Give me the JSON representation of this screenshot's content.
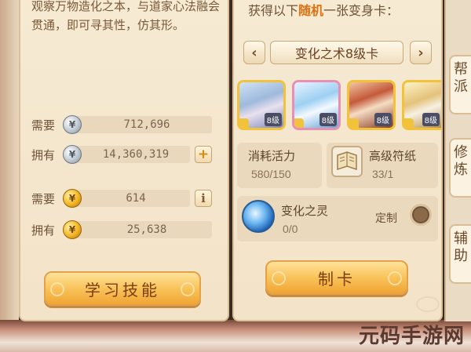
{
  "learn_panel": {
    "description": "观察万物造化之本，与道家心法融会贯通，即可寻其性，仿其形。",
    "silver_required_label": "需要",
    "silver_required_value": "712,696",
    "silver_owned_label": "拥有",
    "silver_owned_value": "14,360,319",
    "gold_required_label": "需要",
    "gold_required_value": "614",
    "gold_owned_label": "拥有",
    "gold_owned_value": "25,638",
    "plus_label": "+",
    "info_label": "i",
    "learn_button": "学习技能"
  },
  "craft_panel": {
    "get_text_prefix": "获得以下",
    "get_text_highlight": "随机",
    "get_text_suffix": "一张变身卡：",
    "prev_label": "‹",
    "next_label": "›",
    "card_type": "变化之术8级卡",
    "cards": [
      {
        "level": "8级"
      },
      {
        "level": "8级"
      },
      {
        "level": "8级"
      },
      {
        "level": "8级"
      }
    ],
    "energy_label": "消耗活力",
    "energy_value": "580/150",
    "paper_label": "高级符纸",
    "paper_value": "33/1",
    "spirit_label": "变化之灵",
    "spirit_value": "0/0",
    "custom_label": "定制",
    "craft_button": "制卡"
  },
  "side_tabs": [
    {
      "label": "帮派"
    },
    {
      "label": "修炼"
    },
    {
      "label": "辅助"
    }
  ],
  "watermark": "元码手游网",
  "colors": {
    "highlight": "#e0700f",
    "panel": "#f6ead3",
    "button": "#f9c35a"
  }
}
